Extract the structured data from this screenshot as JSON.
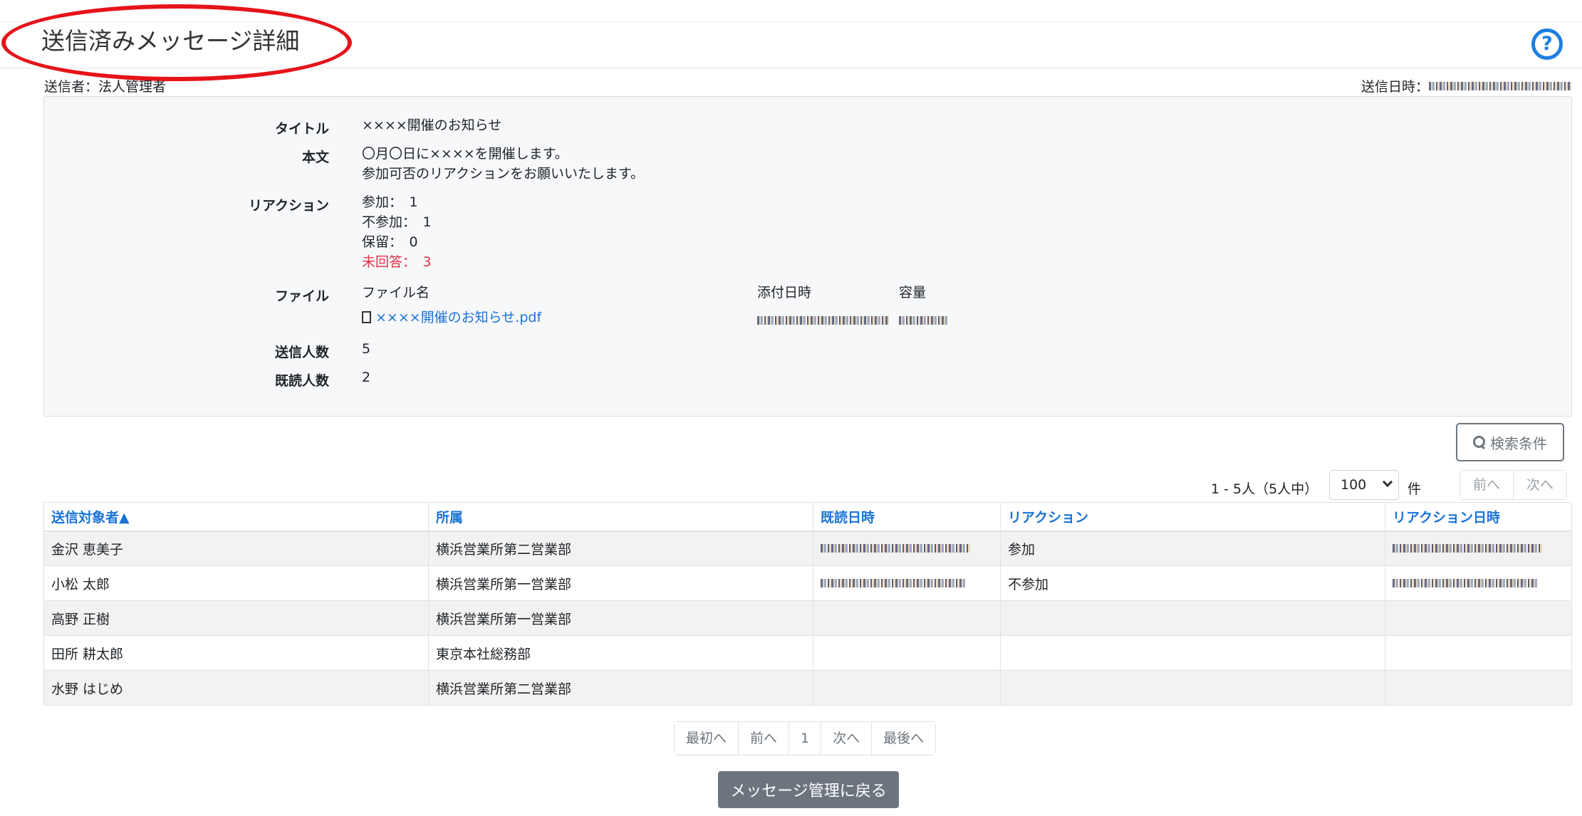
{
  "header": {
    "title": "送信済みメッセージ詳細",
    "help_icon": "question-circle-icon"
  },
  "meta": {
    "sender": "送信者：法人管理者",
    "sent_at_label": "送信日時："
  },
  "details": {
    "title_label": "タイトル",
    "title_value": "××××開催のお知らせ",
    "body_label": "本文",
    "body_line1": "〇月〇日に××××を開催します。",
    "body_line2": "参加可否のリアクションをお願いいたします。",
    "reaction_label": "リアクション",
    "reactions": [
      "参加：　1",
      "不参加：　1",
      "保留：　0"
    ],
    "unanswered": "未回答：　3",
    "file_label": "ファイル",
    "file_col_name": "ファイル名",
    "file_col_date": "添付日時",
    "file_col_size": "容量",
    "file_name": "××××開催のお知らせ.pdf",
    "sent_count_label": "送信人数",
    "sent_count": "5",
    "read_count_label": "既読人数",
    "read_count": "2"
  },
  "toolbar": {
    "search_label": "検索条件",
    "count_text": "1 - 5人（5人中）",
    "per_page": "100",
    "per_page_unit": "件",
    "prev": "前へ",
    "next": "次へ"
  },
  "table": {
    "headers": [
      "送信対象者▲",
      "所属",
      "既読日時",
      "リアクション",
      "リアクション日時"
    ],
    "rows": [
      {
        "name": "金沢 恵美子",
        "dept": "横浜営業所第二営業部",
        "reaction": "参加"
      },
      {
        "name": "小松 太郎",
        "dept": "横浜営業所第一営業部",
        "reaction": "不参加"
      },
      {
        "name": "高野 正樹",
        "dept": "横浜営業所第一営業部",
        "reaction": ""
      },
      {
        "name": "田所 耕太郎",
        "dept": "東京本社総務部",
        "reaction": ""
      },
      {
        "name": "水野 はじめ",
        "dept": "横浜営業所第二営業部",
        "reaction": ""
      }
    ]
  },
  "pagination": {
    "first": "最初へ",
    "prev": "前へ",
    "page": "1",
    "next": "次へ",
    "last": "最後へ"
  },
  "back_button": "メッセージ管理に戻る"
}
